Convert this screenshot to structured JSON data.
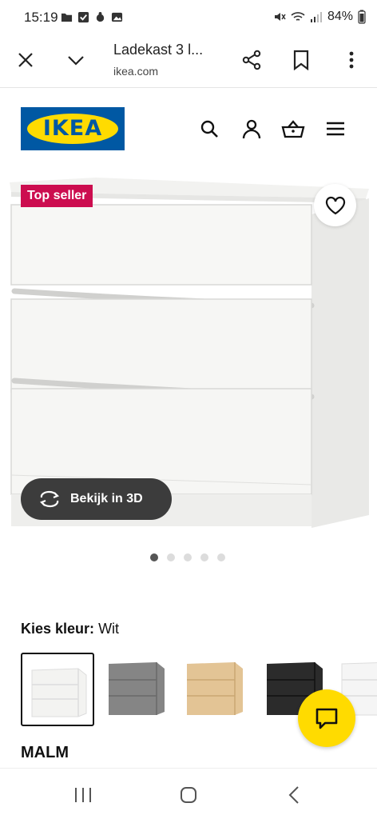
{
  "status_bar": {
    "time": "15:19",
    "battery": "84%"
  },
  "browser": {
    "title": "Ladekast 3 l...",
    "url": "ikea.com",
    "icons": [
      "close-icon",
      "chevron-down-icon",
      "share-icon",
      "bookmark-icon",
      "more-vert-icon"
    ]
  },
  "header": {
    "logo": "IKEA",
    "icons": [
      "search-icon",
      "account-icon",
      "basket-icon",
      "menu-icon"
    ]
  },
  "product_image": {
    "badge": "Top seller",
    "view_3d_label": "Bekijk in 3D",
    "carousel": {
      "count": 5,
      "active_index": 0
    }
  },
  "color_picker": {
    "label": "Kies kleur:",
    "selected": "Wit",
    "options": [
      "wit",
      "grijs",
      "eiken",
      "zwartbruin",
      "hoogglans wit"
    ]
  },
  "product": {
    "name": "MALM"
  },
  "colors": {
    "ikea_blue": "#0058a3",
    "ikea_yellow": "#ffdb00",
    "badge_red": "#cc0d4f"
  }
}
